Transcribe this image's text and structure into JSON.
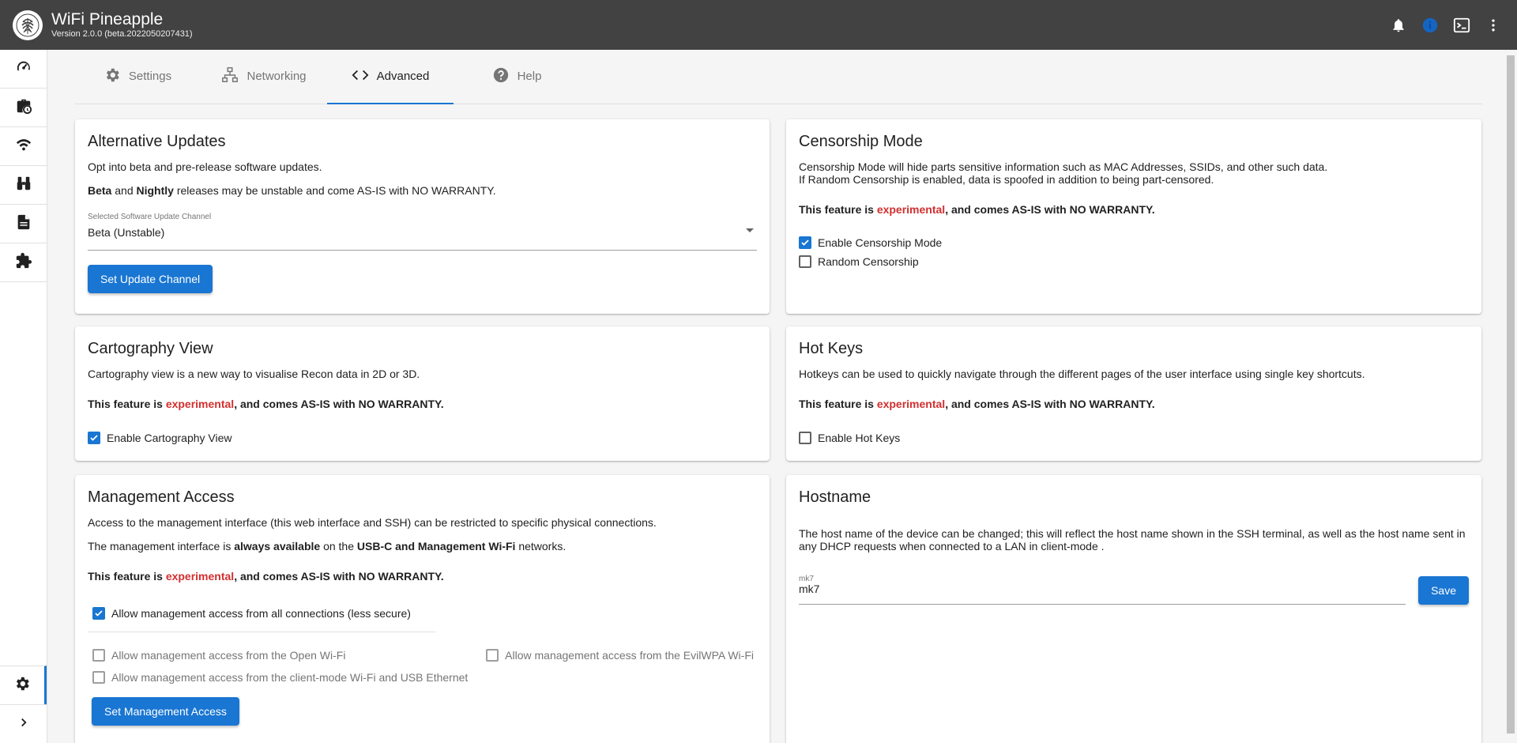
{
  "app": {
    "title": "WiFi Pineapple",
    "version": "Version 2.0.0 (beta.2022050207431)"
  },
  "tabs": [
    {
      "label": "Settings",
      "icon": "gear-icon"
    },
    {
      "label": "Networking",
      "icon": "network-icon"
    },
    {
      "label": "Advanced",
      "icon": "code-icon",
      "active": true
    },
    {
      "label": "Help",
      "icon": "help-icon"
    }
  ],
  "common": {
    "experimental_prefix": "This feature is ",
    "experimental_word": "experimental",
    "experimental_suffix": ", and comes AS-IS with NO WARRANTY."
  },
  "updates": {
    "title": "Alternative Updates",
    "desc": "Opt into beta and pre-release software updates.",
    "beta": "Beta",
    "and": " and ",
    "nightly": "Nightly",
    "warning_rest": " releases may be unstable and come AS-IS with NO WARRANTY.",
    "select_label": "Selected Software Update Channel",
    "select_value": "Beta (Unstable)",
    "button": "Set Update Channel"
  },
  "censorship": {
    "title": "Censorship Mode",
    "desc1": "Censorship Mode will hide parts sensitive information such as MAC Addresses, SSIDs, and other such data.",
    "desc2": "If Random Censorship is enabled, data is spoofed in addition to being part-censored.",
    "enable_label": "Enable Censorship Mode",
    "enable_checked": true,
    "random_label": "Random Censorship",
    "random_checked": false
  },
  "cartography": {
    "title": "Cartography View",
    "desc": "Cartography view is a new way to visualise Recon data in 2D or 3D.",
    "enable_label": "Enable Cartography View",
    "enable_checked": true
  },
  "hotkeys": {
    "title": "Hot Keys",
    "desc": "Hotkeys can be used to quickly navigate through the different pages of the user interface using single key shortcuts.",
    "enable_label": "Enable Hot Keys",
    "enable_checked": false
  },
  "management": {
    "title": "Management Access",
    "desc": "Access to the management interface (this web interface and SSH) can be restricted to specific physical connections.",
    "avail_pre": "The management interface is ",
    "avail_bold": "always available",
    "avail_mid": " on the ",
    "avail_bold2": "USB-C and Management Wi-Fi",
    "avail_post": " networks.",
    "all_label": "Allow management access from all connections (less secure)",
    "all_checked": true,
    "open_label": "Allow management access from the Open Wi-Fi",
    "evil_label": "Allow management access from the EvilWPA Wi-Fi",
    "client_label": "Allow management access from the client-mode Wi-Fi and USB Ethernet",
    "button": "Set Management Access"
  },
  "hostname": {
    "title": "Hostname",
    "desc": "The host name of the device can be changed; this will reflect the host name shown in the SSH terminal, as well as the host name sent in any DHCP requests when connected to a LAN in client-mode .",
    "field_label": "mk7",
    "field_value": "mk7",
    "button": "Save"
  },
  "colors": {
    "accent": "#1976d2",
    "topbar": "#424242",
    "experimental": "#d32f2f"
  }
}
